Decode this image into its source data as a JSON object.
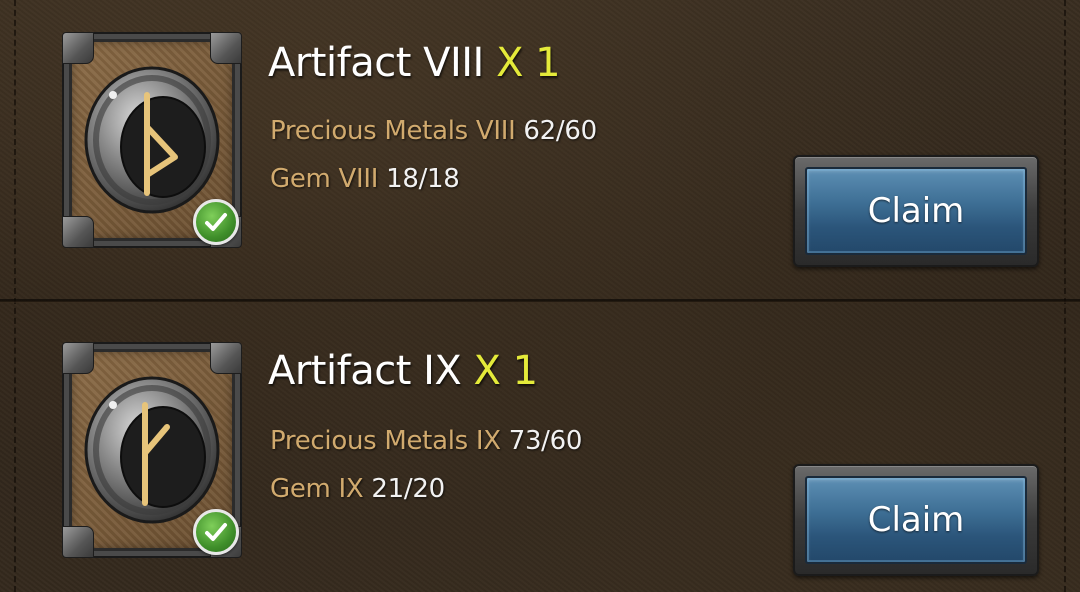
{
  "rewards": [
    {
      "title": "Artifact VIII",
      "quantity": "X 1",
      "rune": "rune-thurisaz-icon",
      "requirements": [
        {
          "name": "Precious Metals VIII",
          "count": "62/60"
        },
        {
          "name": "Gem VIII",
          "count": "18/18"
        }
      ],
      "claim_label": "Claim"
    },
    {
      "title": "Artifact IX",
      "quantity": "X 1",
      "rune": "rune-kaunan-icon",
      "requirements": [
        {
          "name": "Precious Metals IX",
          "count": "73/60"
        },
        {
          "name": "Gem IX",
          "count": "21/20"
        }
      ],
      "claim_label": "Claim"
    }
  ],
  "colors": {
    "quantity": "#e4ea3a",
    "requirement_name": "#d1aa6e",
    "claim_button": "#3e6f95",
    "check_badge": "#3f8f2a"
  }
}
